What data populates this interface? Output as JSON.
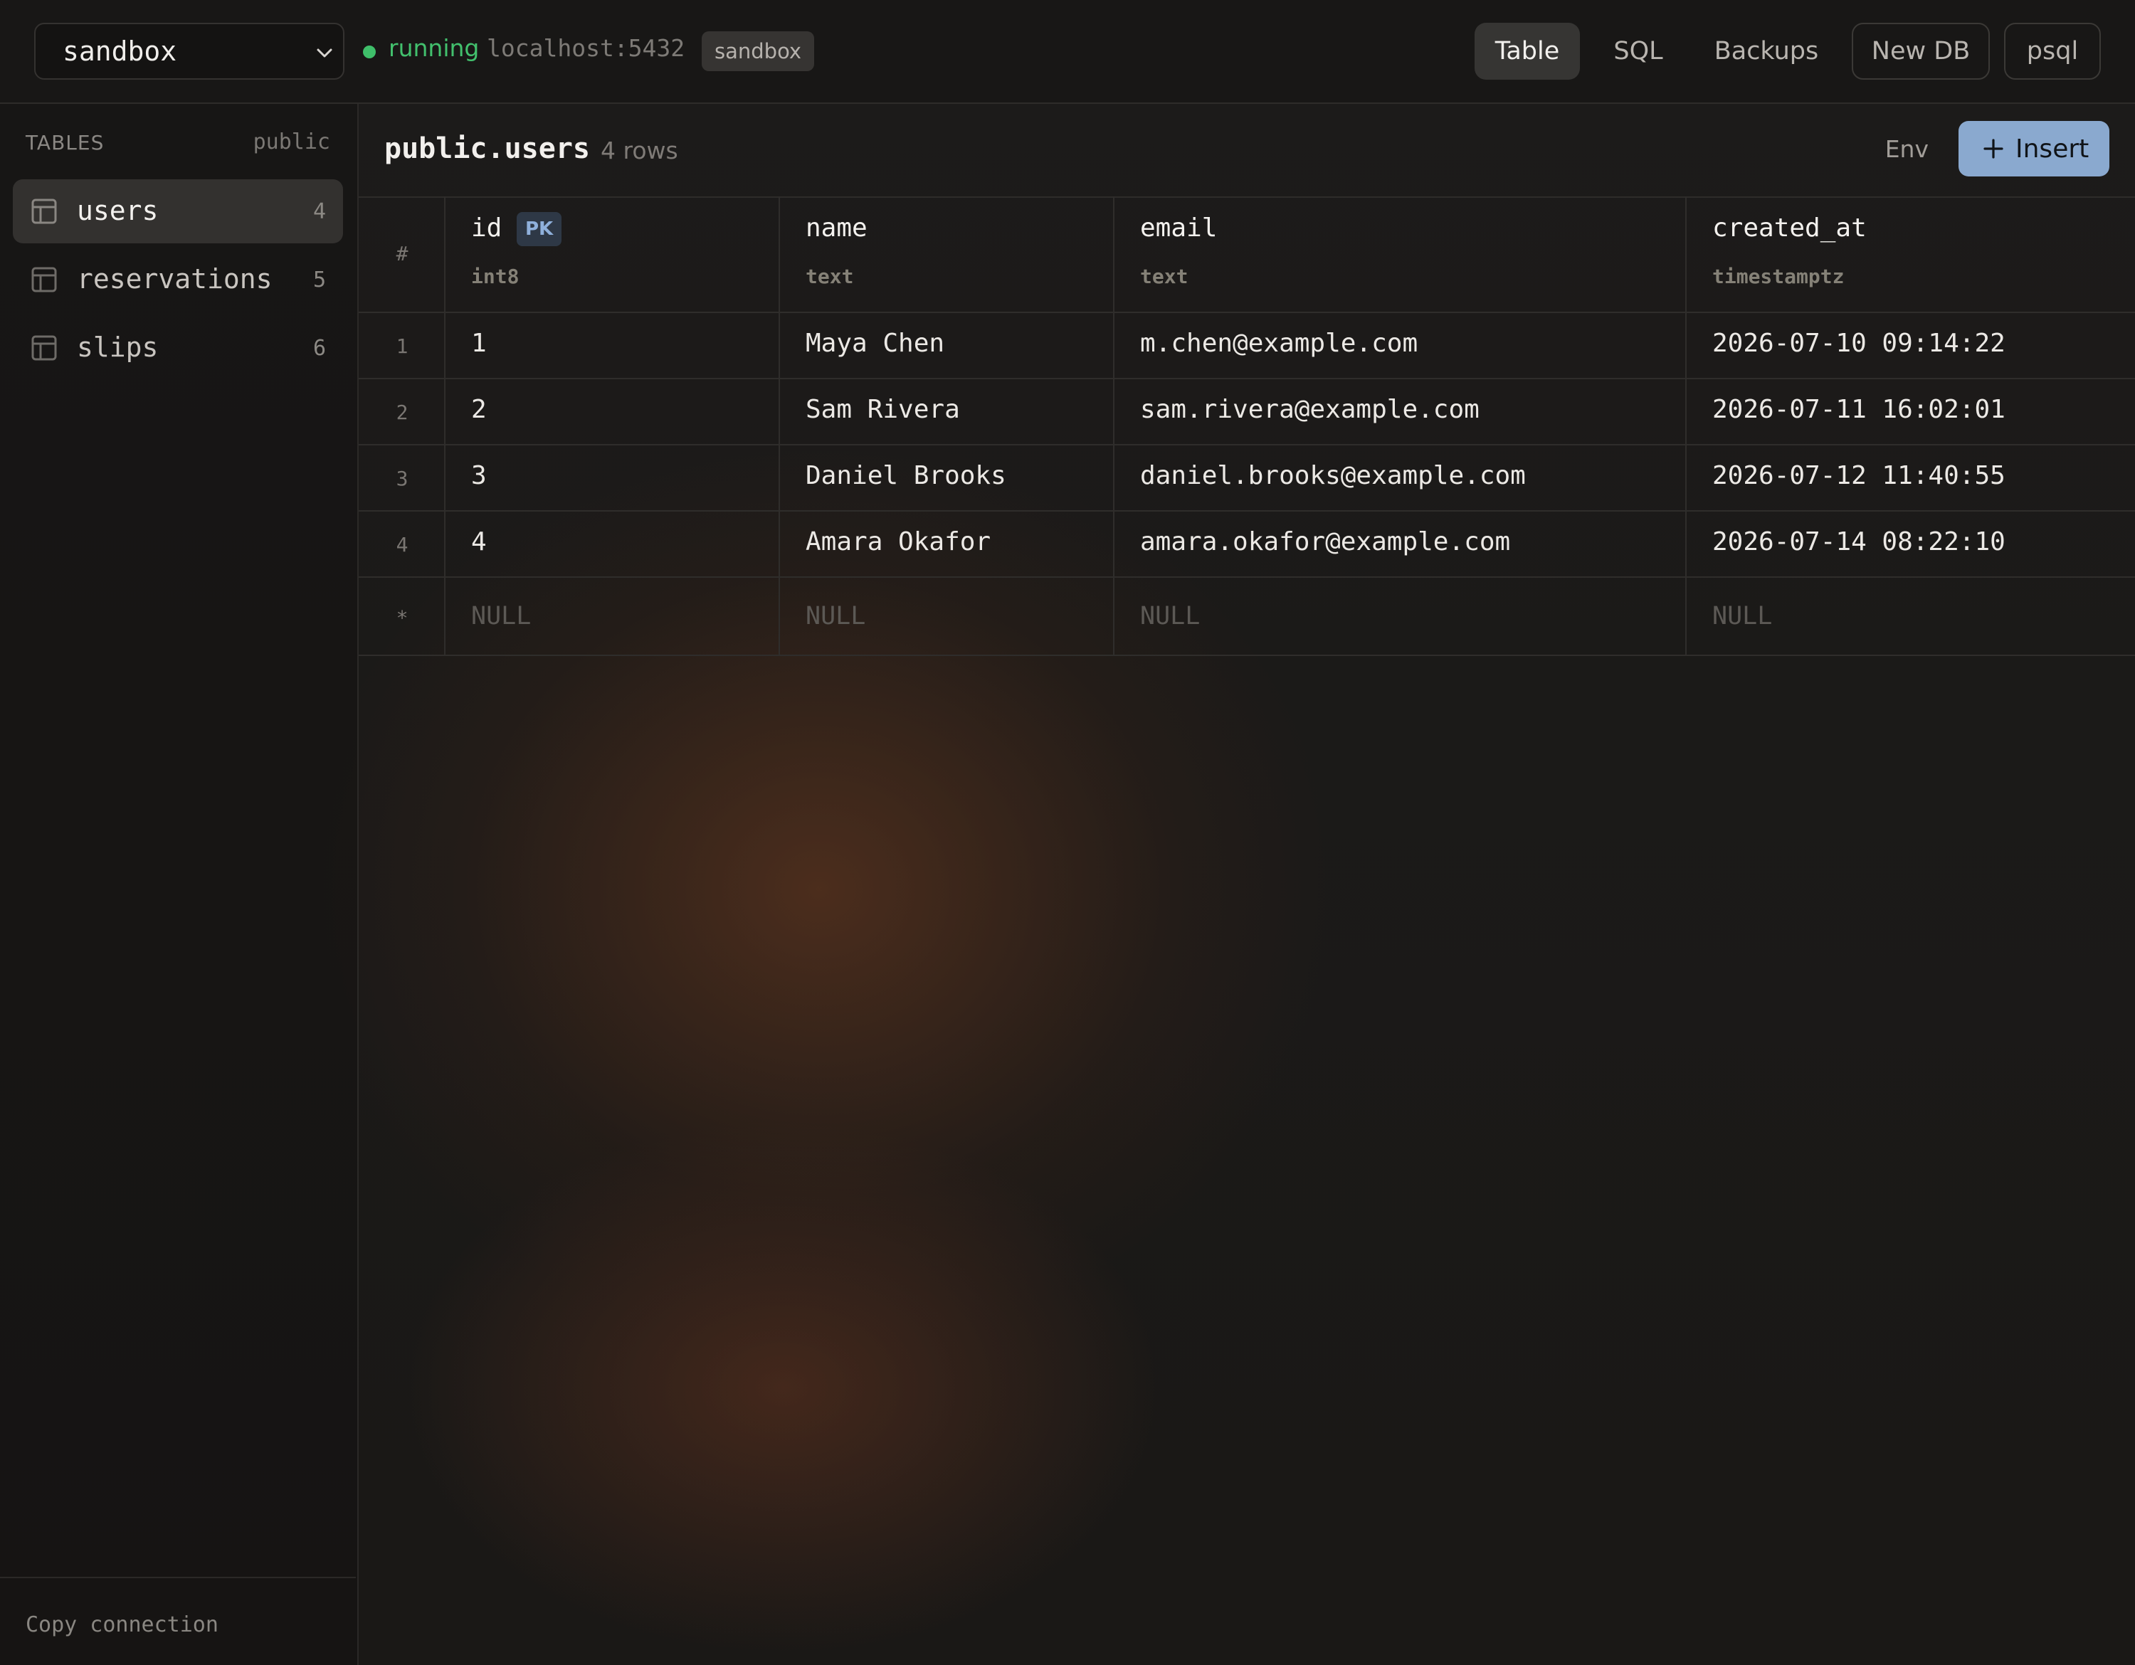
{
  "topbar": {
    "db_select": "sandbox",
    "status": "running",
    "host": "localhost:5432",
    "env_badge": "sandbox",
    "nav": {
      "table": "Table",
      "sql": "SQL",
      "backups": "Backups",
      "new_db": "New DB",
      "psql": "psql"
    },
    "active_tab": "Table"
  },
  "sidebar": {
    "heading": "TABLES",
    "schema": "public",
    "items": [
      {
        "name": "users",
        "count": "4",
        "active": true
      },
      {
        "name": "reservations",
        "count": "5",
        "active": false
      },
      {
        "name": "slips",
        "count": "6",
        "active": false
      }
    ],
    "footer": "Copy connection"
  },
  "main": {
    "title": "public.users",
    "row_count": "4 rows",
    "env_link": "Env",
    "insert_label": "Insert"
  },
  "table": {
    "num_header": "#",
    "columns": [
      {
        "name": "id",
        "type": "int8",
        "pk": "PK"
      },
      {
        "name": "name",
        "type": "text"
      },
      {
        "name": "email",
        "type": "text"
      },
      {
        "name": "created_at",
        "type": "timestamptz"
      }
    ],
    "rows": [
      {
        "num": "1",
        "id": "1",
        "name": "Maya Chen",
        "email": "m.chen@example.com",
        "created_at": "2026-07-10 09:14:22"
      },
      {
        "num": "2",
        "id": "2",
        "name": "Sam Rivera",
        "email": "sam.rivera@example.com",
        "created_at": "2026-07-11 16:02:01"
      },
      {
        "num": "3",
        "id": "3",
        "name": "Daniel Brooks",
        "email": "daniel.brooks@example.com",
        "created_at": "2026-07-12 11:40:55"
      },
      {
        "num": "4",
        "id": "4",
        "name": "Amara Okafor",
        "email": "amara.okafor@example.com",
        "created_at": "2026-07-14 08:22:10"
      }
    ],
    "new_row": {
      "marker": "*",
      "null_text": "NULL"
    }
  },
  "colors": {
    "accent": "#8aa9cf",
    "running": "#42c06d",
    "background": "#181716"
  }
}
